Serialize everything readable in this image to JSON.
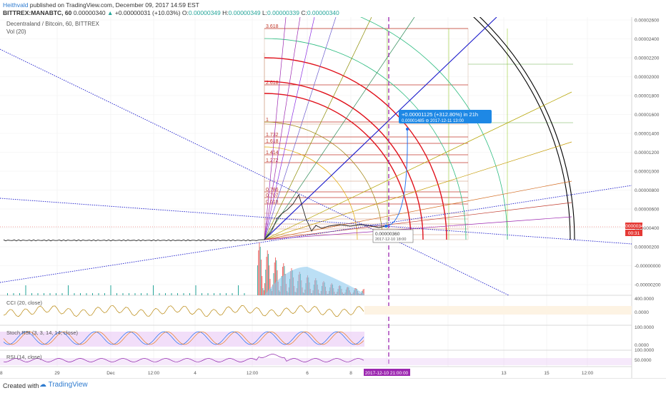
{
  "header": {
    "author": "Heithvald",
    "published": " published on TradingView.com, December 09, 2017 14:59 EST",
    "symbol": "BITTREX:MANABTC, 60",
    "price": "0.00000340",
    "change": "+0.00000031 (+10.03%)",
    "o_label": "O:",
    "o": "0.00000349",
    "h_label": "H:",
    "h": "0.00000349",
    "l_label": "L:",
    "l": "0.00000339",
    "c_label": "C:",
    "c": "0.00000340"
  },
  "legend": {
    "title": "Decentraland / Bitcoin, 60, BITTREX",
    "vol": "Vol (20)"
  },
  "indicators": {
    "cci": "CCI (20, close)",
    "stoch": "Stoch RSI (3, 3, 14, 14, close)",
    "rsi": "RSI (14, close)"
  },
  "footer": {
    "created": "Created with",
    "brand": "TradingView"
  },
  "annotation": {
    "gain": "+0.00001125 (+312.80%) in 21h",
    "target": "0.00001485  ⊖ 2017-12-11  13:00",
    "low_price": "0.00000360",
    "low_time": "2017-12-10  18:00"
  },
  "price_tag": {
    "value": "0.00000340",
    "countdown": "00:31"
  },
  "time_highlight": "2017-12-10 21:00:00",
  "colors": {
    "fib_line": "#c0392b",
    "fan_red": "#e0101a",
    "fan_green": "#2bbb7f",
    "trend_blue": "#1a1acb",
    "cursor": "#9c27b0",
    "volume_up": "#26a69a",
    "volume_down": "#ef5350",
    "volume_ma": "#8ec9ef",
    "osc_fill": "#e9c8f5"
  },
  "chart_data": {
    "type": "line",
    "title": "Decentraland / Bitcoin, 60, BITTREX",
    "price_axis": {
      "ticks": [
        "0.00002600",
        "0.00002400",
        "0.00002200",
        "0.00002000",
        "0.00001800",
        "0.00001600",
        "0.00001400",
        "0.00001200",
        "0.00001000",
        "0.00000800",
        "0.00000600",
        "0.00000400",
        "0.00000200",
        "-0.00000000",
        "-0.00000200"
      ],
      "range": [
        -2e-06,
        2.6e-05
      ]
    },
    "time_axis": {
      "ticks": [
        "29",
        "Dec",
        "12:00",
        "4",
        "12:00",
        "6",
        "8",
        "12:00",
        "2017-12-10 21:00:00",
        "13",
        "15",
        "12:00",
        "18"
      ]
    },
    "fib_levels": [
      "3.618",
      "2.618",
      "1",
      "1.732",
      "1.618",
      "1.414",
      "1.272",
      "0.786",
      "0.707",
      "0.618"
    ],
    "series": [
      {
        "name": "price",
        "x": [
          "Nov 27",
          "Nov 29",
          "Dec 1",
          "Dec 3",
          "Dec 5",
          "Dec 6",
          "Dec 7 06:00",
          "Dec 7 12:00",
          "Dec 7 20:00",
          "Dec 8",
          "Dec 9",
          "Dec 10",
          "Dec 10 18:00"
        ],
        "y": [
          2.9e-06,
          2.9e-06,
          2.9e-06,
          2.9e-06,
          2.9e-06,
          3e-06,
          6.2e-06,
          7.8e-06,
          5.6e-06,
          3.8e-06,
          3.6e-06,
          3.4e-06,
          3.4e-06
        ]
      },
      {
        "name": "projection",
        "x": [
          "Dec 10 18:00",
          "Dec 11 13:00"
        ],
        "y": [
          3.6e-06,
          1.485e-05
        ]
      }
    ],
    "cci_axis": [
      "400.0000",
      "0.0000"
    ],
    "stoch_axis": [
      "100.0000",
      "0.0000"
    ],
    "rsi_axis": [
      "100.0000",
      "50.0000"
    ]
  }
}
